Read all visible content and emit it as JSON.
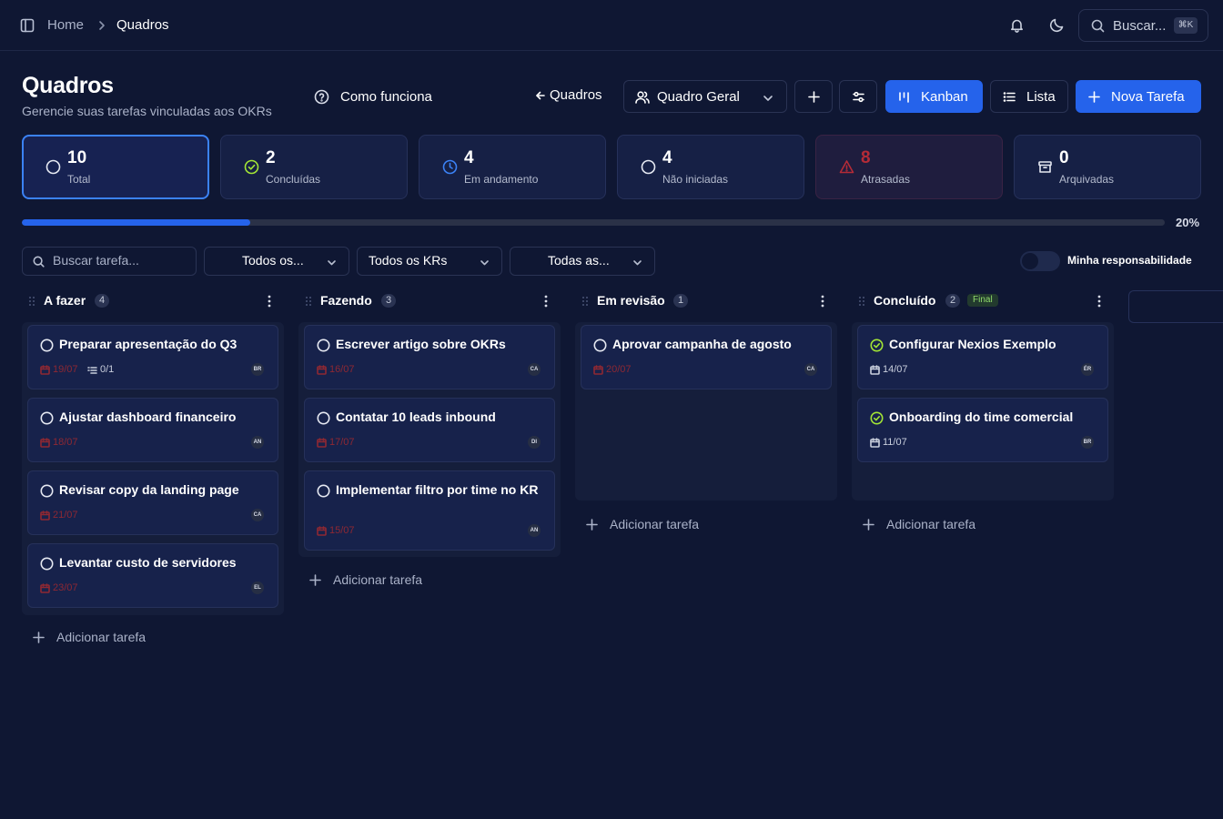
{
  "topbar": {
    "breadcrumb_home": "Home",
    "breadcrumb_current": "Quadros",
    "search_placeholder": "Buscar...",
    "search_shortcut": "⌘K"
  },
  "header": {
    "title": "Quadros",
    "subtitle": "Gerencie suas tarefas vinculadas aos OKRs",
    "how_it_works": "Como funciona",
    "back_link": "Quadros",
    "board_select": "Quadro Geral",
    "view_kanban": "Kanban",
    "view_list": "Lista",
    "new_task": "Nova Tarefa"
  },
  "stats": [
    {
      "value": "10",
      "label": "Total"
    },
    {
      "value": "2",
      "label": "Concluídas"
    },
    {
      "value": "4",
      "label": "Em andamento"
    },
    {
      "value": "4",
      "label": "Não iniciadas"
    },
    {
      "value": "8",
      "label": "Atrasadas"
    },
    {
      "value": "0",
      "label": "Arquivadas"
    }
  ],
  "progress": {
    "percent": 20,
    "label": "20%"
  },
  "filters": {
    "search_placeholder": "Buscar tarefa...",
    "filter1": "Todos os...",
    "filter2": "Todos os KRs",
    "filter3": "Todas as...",
    "my_responsibility": "Minha responsabilidade"
  },
  "add_task_label": "Adicionar tarefa",
  "columns": [
    {
      "name": "A fazer",
      "count": "4",
      "cards": [
        {
          "title": "Preparar apresentação do Q3",
          "date": "19/07",
          "subtasks": "0/1",
          "avatar": "BR",
          "done": false
        },
        {
          "title": "Ajustar dashboard financeiro",
          "date": "18/07",
          "avatar": "AN",
          "done": false
        },
        {
          "title": "Revisar copy da landing page",
          "date": "21/07",
          "avatar": "CA",
          "done": false
        },
        {
          "title": "Levantar custo de servidores",
          "date": "23/07",
          "avatar": "EL",
          "done": false
        }
      ]
    },
    {
      "name": "Fazendo",
      "count": "3",
      "cards": [
        {
          "title": "Escrever artigo sobre OKRs",
          "date": "16/07",
          "avatar": "CA",
          "done": false
        },
        {
          "title": "Contatar 10 leads inbound",
          "date": "17/07",
          "avatar": "DI",
          "done": false
        },
        {
          "title": "Implementar filtro por time no KR",
          "date": "15/07",
          "avatar": "AN",
          "done": false
        }
      ]
    },
    {
      "name": "Em revisão",
      "count": "1",
      "cards": [
        {
          "title": "Aprovar campanha de agosto",
          "date": "20/07",
          "avatar": "CA",
          "done": false
        }
      ]
    },
    {
      "name": "Concluído",
      "count": "2",
      "badge": "Final",
      "cards": [
        {
          "title": "Configurar Nexios Exemplo",
          "date": "14/07",
          "avatar": "ÉR",
          "done": true
        },
        {
          "title": "Onboarding do time comercial",
          "date": "11/07",
          "avatar": "BR",
          "done": true
        }
      ]
    }
  ],
  "colors": {
    "background": "#0f1733",
    "accent": "#2563eb",
    "late": "#8e2833",
    "done": "#a3e635"
  }
}
